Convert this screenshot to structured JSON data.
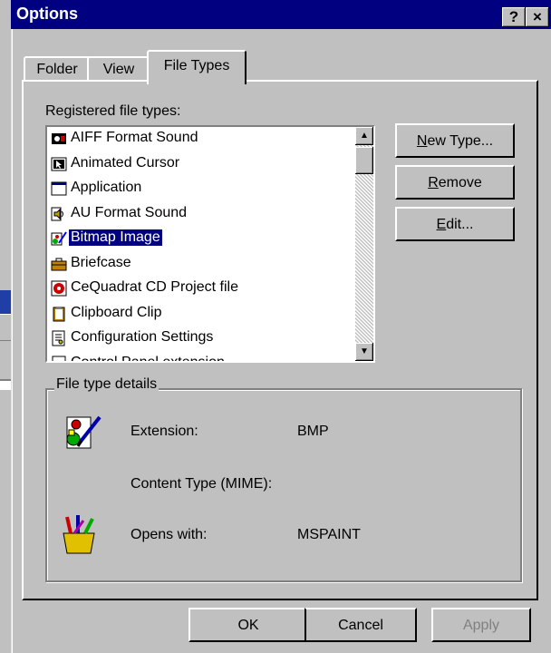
{
  "dialog": {
    "title": "Options",
    "help_glyph": "?",
    "close_glyph": "×"
  },
  "tabs": [
    {
      "label": "Folder",
      "active": false
    },
    {
      "label": "View",
      "active": false
    },
    {
      "label": "File Types",
      "active": true
    }
  ],
  "registered": {
    "label": "Registered file types:",
    "items": [
      {
        "label": "AIFF Format Sound",
        "icon": "sound-icon",
        "selected": false
      },
      {
        "label": "Animated Cursor",
        "icon": "cursor-icon",
        "selected": false
      },
      {
        "label": "Application",
        "icon": "application-window-icon",
        "selected": false
      },
      {
        "label": "AU Format Sound",
        "icon": "speaker-icon",
        "selected": false
      },
      {
        "label": "Bitmap Image",
        "icon": "paint-icon",
        "selected": true
      },
      {
        "label": "Briefcase",
        "icon": "briefcase-icon",
        "selected": false
      },
      {
        "label": "CeQuadrat CD Project file",
        "icon": "cd-project-icon",
        "selected": false
      },
      {
        "label": "Clipboard Clip",
        "icon": "clipboard-icon",
        "selected": false
      },
      {
        "label": "Configuration Settings",
        "icon": "settings-file-icon",
        "selected": false
      },
      {
        "label": "Control Panel extension",
        "icon": "control-panel-icon",
        "selected": false
      }
    ]
  },
  "buttons": {
    "new_type_a": "N",
    "new_type_b": "ew Type...",
    "remove_a": "R",
    "remove_b": "emove",
    "edit_a": "E",
    "edit_b": "dit...",
    "ok": "OK",
    "cancel": "Cancel",
    "apply": "Apply"
  },
  "details": {
    "group_title": "File type details",
    "extension_label": "Extension:",
    "extension_value": "BMP",
    "mime_label": "Content Type (MIME):",
    "opens_label": "Opens with:",
    "opens_value": "MSPAINT"
  },
  "colors": {
    "selection": "#000080",
    "titlebar": "#000080",
    "face": "#c0c0c0"
  }
}
